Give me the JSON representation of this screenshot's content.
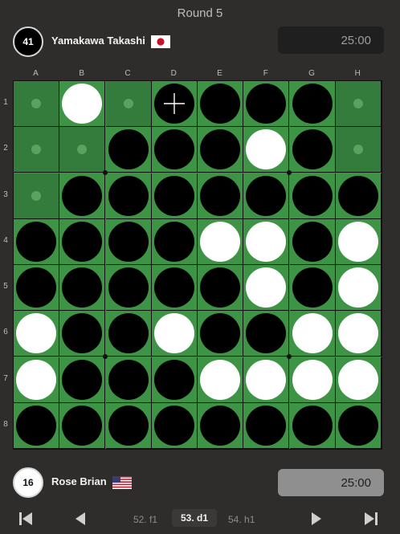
{
  "round_label": "Round 5",
  "players": {
    "black": {
      "name": "Yamakawa Takashi",
      "disc_count": "41",
      "flag": "japan-flag-icon",
      "clock": "25:00"
    },
    "white": {
      "name": "Rose Brian",
      "disc_count": "16",
      "flag": "usa-flag-icon",
      "clock": "25:00"
    }
  },
  "board": {
    "columns": [
      "A",
      "B",
      "C",
      "D",
      "E",
      "F",
      "G",
      "H"
    ],
    "rows": [
      "1",
      "2",
      "3",
      "4",
      "5",
      "6",
      "7",
      "8"
    ],
    "cells": [
      [
        "h",
        "W",
        "h",
        "B",
        "B",
        "B",
        "B",
        "h"
      ],
      [
        "h",
        "h",
        "B",
        "B",
        "B",
        "W",
        "B",
        "h"
      ],
      [
        "h",
        "B",
        "B",
        "B",
        "B",
        "B",
        "B",
        "B"
      ],
      [
        "B",
        "B",
        "B",
        "B",
        "W",
        "W",
        "B",
        "W"
      ],
      [
        "B",
        "B",
        "B",
        "B",
        "B",
        "W",
        "B",
        "W"
      ],
      [
        "W",
        "B",
        "B",
        "W",
        "B",
        "B",
        "W",
        "W"
      ],
      [
        "W",
        "B",
        "B",
        "B",
        "W",
        "W",
        "W",
        "W"
      ],
      [
        "B",
        "B",
        "B",
        "B",
        "B",
        "B",
        "B",
        "B"
      ]
    ],
    "cell_legend": {
      "B": "black disc",
      "W": "white disc",
      "h": "empty legal move hint"
    },
    "last_move": "d1",
    "colors": {
      "board_green": "#3e9445",
      "hint_cell": "#347c3b",
      "hint_dot": "#58a35e"
    }
  },
  "move_nav": {
    "prev_move": "52. f1",
    "current_move": "53. d1",
    "next_move": "54. h1"
  }
}
